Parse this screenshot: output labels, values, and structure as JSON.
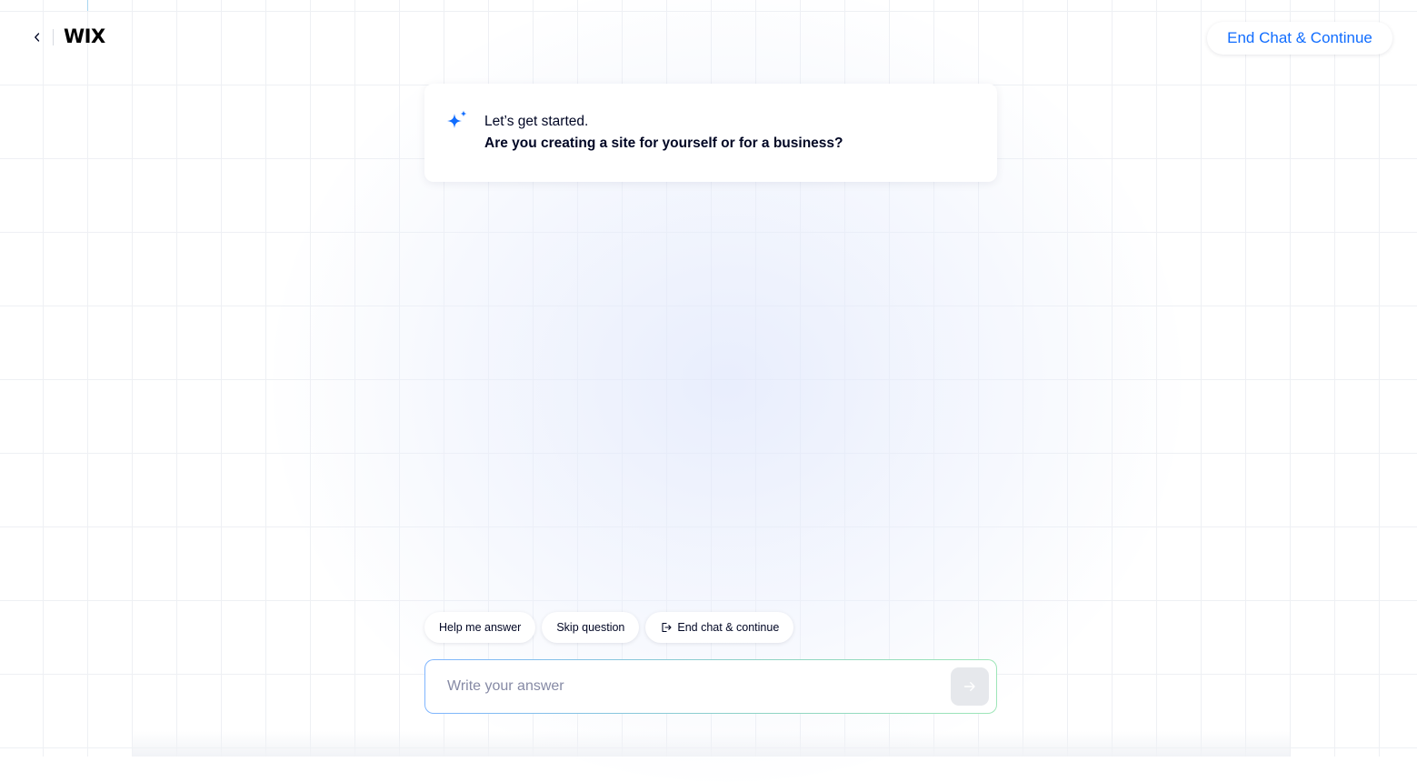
{
  "header": {
    "logo_text": "WIX",
    "end_chat_button_label": "End Chat & Continue",
    "back_icon": "chevron-left-icon"
  },
  "message": {
    "icon": "sparkle-icon",
    "greeting": "Let’s get started.",
    "question": "Are you creating a site for yourself or for a business?"
  },
  "suggestions": {
    "help_label": "Help me answer",
    "skip_label": "Skip question",
    "end_chat_label": "End chat & continue",
    "end_chat_icon": "exit-icon"
  },
  "answer": {
    "placeholder": "Write your answer",
    "value": "",
    "send_icon": "arrow-right-icon"
  },
  "colors": {
    "accent": "#116dff",
    "text": "#000624",
    "placeholder": "#868aa5",
    "send_button_bg": "#e6e8ec"
  }
}
